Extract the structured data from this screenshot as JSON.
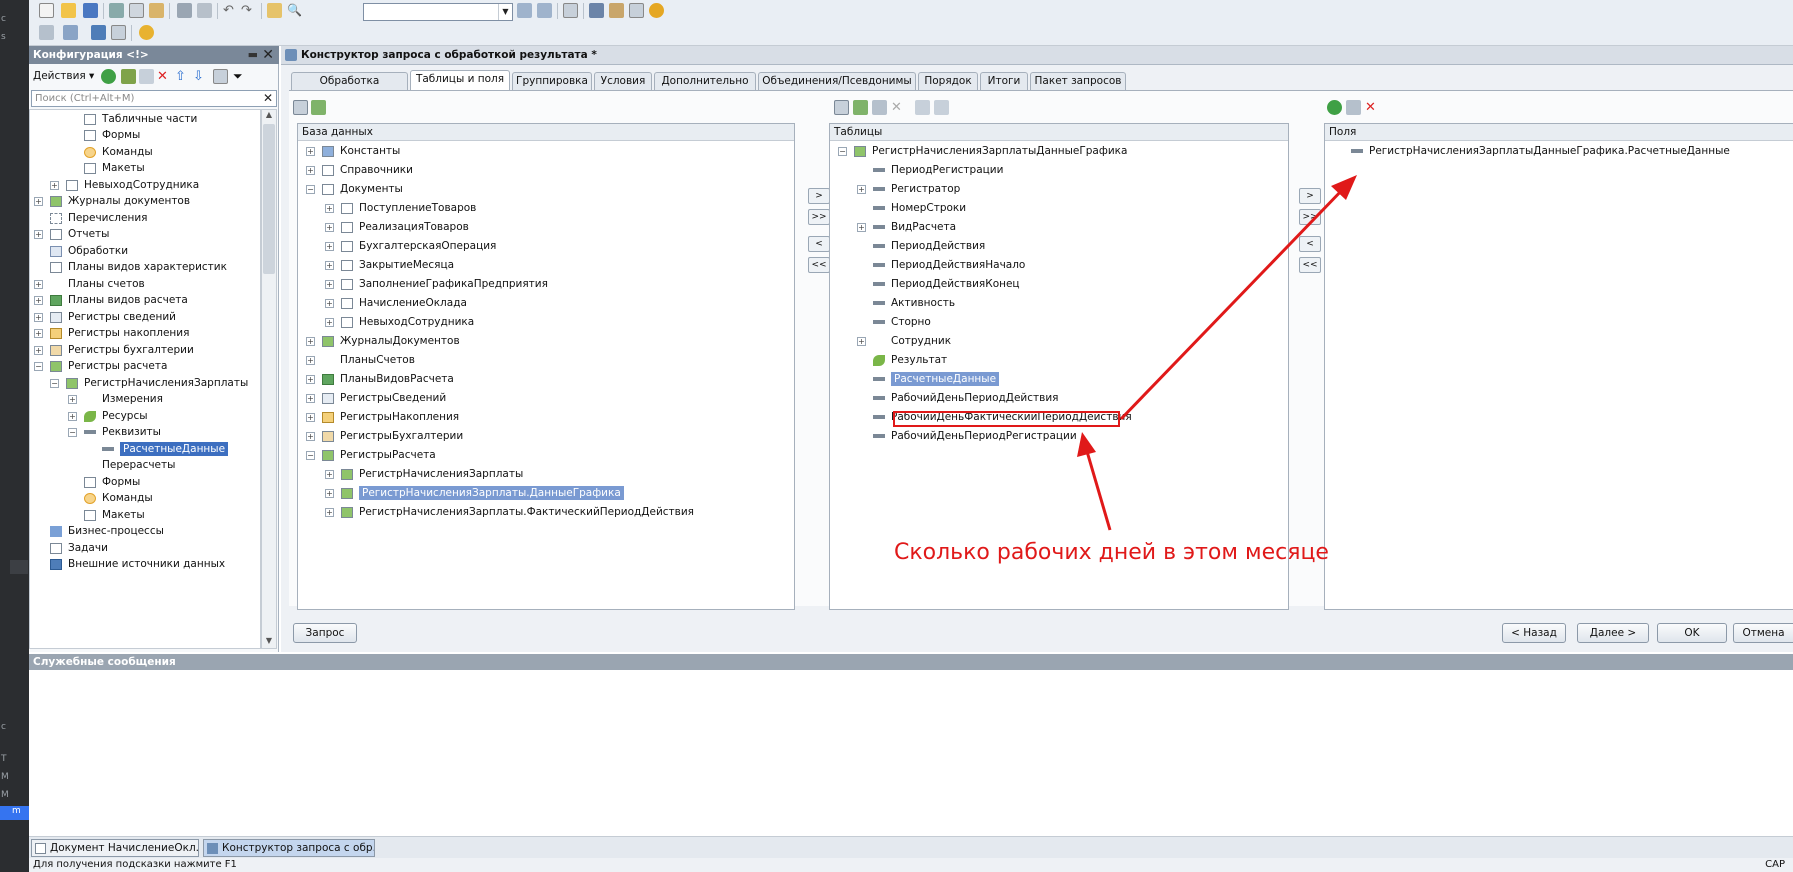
{
  "left_strip": {
    "items": [
      "c",
      "s",
      "c",
      "T",
      "M",
      "M",
      "m"
    ]
  },
  "toolbar": {
    "search_value": "",
    "search_dropdown_icon": "chevron-down-icon"
  },
  "config_panel": {
    "title": "Конфигурация <!>",
    "actions_label": "Действия",
    "search_placeholder": "Поиск (Ctrl+Alt+M)",
    "tree": [
      {
        "label": "Табличные части",
        "indent": 3
      },
      {
        "label": "Формы",
        "indent": 3
      },
      {
        "label": "Команды",
        "indent": 3
      },
      {
        "label": "Макеты",
        "indent": 3
      },
      {
        "label": "НевыходСотрудника",
        "indent": 2
      },
      {
        "label": "Журналы документов",
        "indent": 1
      },
      {
        "label": "Перечисления",
        "indent": 1
      },
      {
        "label": "Отчеты",
        "indent": 1
      },
      {
        "label": "Обработки",
        "indent": 1
      },
      {
        "label": "Планы видов характеристик",
        "indent": 1
      },
      {
        "label": "Планы счетов",
        "indent": 1
      },
      {
        "label": "Планы видов расчета",
        "indent": 1
      },
      {
        "label": "Регистры сведений",
        "indent": 1
      },
      {
        "label": "Регистры накопления",
        "indent": 1
      },
      {
        "label": "Регистры бухгалтерии",
        "indent": 1
      },
      {
        "label": "Регистры расчета",
        "indent": 1
      },
      {
        "label": "РегистрНачисленияЗарплаты",
        "indent": 2
      },
      {
        "label": "Измерения",
        "indent": 3
      },
      {
        "label": "Ресурсы",
        "indent": 3
      },
      {
        "label": "Реквизиты",
        "indent": 3
      },
      {
        "label": "РасчетныеДанные",
        "indent": 4
      },
      {
        "label": "Перерасчеты",
        "indent": 3
      },
      {
        "label": "Формы",
        "indent": 3
      },
      {
        "label": "Команды",
        "indent": 3
      },
      {
        "label": "Макеты",
        "indent": 3
      },
      {
        "label": "Бизнес-процессы",
        "indent": 1
      },
      {
        "label": "Задачи",
        "indent": 1
      },
      {
        "label": "Внешние источники данных",
        "indent": 1
      }
    ]
  },
  "main_window": {
    "title": "Конструктор запроса с обработкой результата *",
    "tabs": [
      "Обработка результата",
      "Таблицы и поля",
      "Группировка",
      "Условия",
      "Дополнительно",
      "Объединения/Псевдонимы",
      "Порядок",
      "Итоги",
      "Пакет запросов"
    ],
    "active_tab": "Таблицы и поля",
    "database": {
      "header": "База данных",
      "items": [
        "Константы",
        "Справочники",
        "Документы",
        "ПоступлениеТоваров",
        "РеализацияТоваров",
        "БухгалтерскаяОперация",
        "ЗакрытиеМесяца",
        "ЗаполнениеГрафикаПредприятия",
        "НачислениеОклада",
        "НевыходСотрудника",
        "ЖурналыДокументов",
        "ПланыСчетов",
        "ПланыВидовРасчета",
        "РегистрыСведений",
        "РегистрыНакопления",
        "РегистрыБухгалтерии",
        "РегистрыРасчета",
        "РегистрНачисленияЗарплаты",
        "РегистрНачисленияЗарплаты.ДанныеГрафика",
        "РегистрНачисленияЗарплаты.ФактическийПериодДействия"
      ]
    },
    "move_buttons": [
      ">",
      ">>",
      "<",
      "<<"
    ],
    "tables": {
      "header": "Таблицы",
      "items": [
        "РегистрНачисленияЗарплатыДанныеГрафика",
        "ПериодРегистрации",
        "Регистратор",
        "НомерСтроки",
        "ВидРасчета",
        "ПериодДействия",
        "ПериодДействияНачало",
        "ПериодДействияКонец",
        "Активность",
        "Сторно",
        "Сотрудник",
        "Результат",
        "РасчетныеДанные",
        "РабочийДеньПериодДействия",
        "РабочийДеньФактическийПериодДействия",
        "РабочийДеньПериодРегистрации"
      ]
    },
    "fields": {
      "header": "Поля",
      "items": [
        "РегистрНачисленияЗарплатыДанныеГрафика.РасчетныеДанные"
      ]
    },
    "buttons": {
      "query": "Запрос",
      "back": "< Назад",
      "next": "Далее >",
      "ok": "OK",
      "cancel": "Отмена"
    }
  },
  "annotation": "Сколько рабочих дней в этом месяце",
  "messages": {
    "title": "Служебные сообщения"
  },
  "taskbar": [
    "Документ НачислениеОкл...",
    "Конструктор запроса с обр..."
  ],
  "status": {
    "hint": "Для получения подсказки нажмите F1",
    "cap": "CAP"
  },
  "colors": {
    "accent": "#3d6fc0",
    "annotation": "#e01919"
  }
}
